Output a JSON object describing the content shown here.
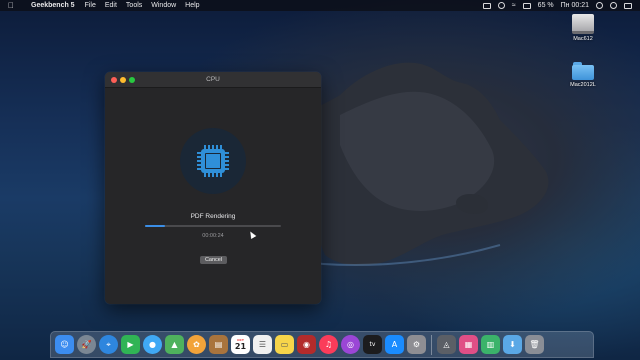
{
  "menubar": {
    "app_name": "Geekbench 5",
    "items": [
      "File",
      "Edit",
      "Tools",
      "Window",
      "Help"
    ],
    "battery": "65 %",
    "clock": "Пн 00:21"
  },
  "desktop": {
    "icons": [
      {
        "label": "Mac612",
        "icon": "hard-drive-icon"
      },
      {
        "label": "Mac2012L",
        "icon": "folder-icon"
      }
    ]
  },
  "window": {
    "title": "CPU",
    "task_label": "PDF Rendering",
    "progress": 0.15,
    "elapsed": "00:00:24",
    "cancel_label": "Cancel"
  },
  "dock": {
    "apps": [
      {
        "name": "finder-icon",
        "glyph": "☺",
        "color": "#3c8df0"
      },
      {
        "name": "launchpad-icon",
        "glyph": "🚀",
        "color": "#7b8794"
      },
      {
        "name": "safari-icon",
        "glyph": "⌖",
        "color": "#2e86de"
      },
      {
        "name": "facetime-icon",
        "glyph": "▶",
        "color": "#30b455"
      },
      {
        "name": "messages-icon",
        "glyph": "●",
        "color": "#40a9f5"
      },
      {
        "name": "maps-icon",
        "glyph": "▲",
        "color": "#4fb25d"
      },
      {
        "name": "photos-icon",
        "glyph": "✿",
        "color": "#f2a33a"
      },
      {
        "name": "notes-brown-icon",
        "glyph": "▤",
        "color": "#a9743d"
      },
      {
        "name": "calendar-icon",
        "glyph": "21",
        "color": "#ffffff"
      },
      {
        "name": "reminders-icon",
        "glyph": "☰",
        "color": "#f0f0f0"
      },
      {
        "name": "notes-icon",
        "glyph": "▭",
        "color": "#f7d54a"
      },
      {
        "name": "photo-booth-icon",
        "glyph": "◉",
        "color": "#b32b2b"
      },
      {
        "name": "music-icon",
        "glyph": "♫",
        "color": "#fb3c5a"
      },
      {
        "name": "podcasts-icon",
        "glyph": "◎",
        "color": "#9b46d6"
      },
      {
        "name": "apple-tv-icon",
        "glyph": "tv",
        "color": "#1c1c1e"
      },
      {
        "name": "app-store-icon",
        "glyph": "A",
        "color": "#1a8cff"
      },
      {
        "name": "system-preferences-icon",
        "glyph": "⚙",
        "color": "#8e8e93"
      },
      {
        "name": "geekbench-icon",
        "glyph": "◬",
        "color": "#5b5f66"
      },
      {
        "name": "pink-app-icon",
        "glyph": "▦",
        "color": "#e04f86"
      },
      {
        "name": "green-app-icon",
        "glyph": "▥",
        "color": "#3bb36a"
      },
      {
        "name": "downloads-folder-icon",
        "glyph": "⬇",
        "color": "#5aa8e6"
      },
      {
        "name": "trash-icon",
        "glyph": "🗑",
        "color": "#8a8e96"
      }
    ],
    "calendar_month": "OCT",
    "calendar_day": "21"
  },
  "colors": {
    "accent": "#3b8ee6",
    "window_bg": "#262628",
    "chip": "#2f8fd8"
  }
}
